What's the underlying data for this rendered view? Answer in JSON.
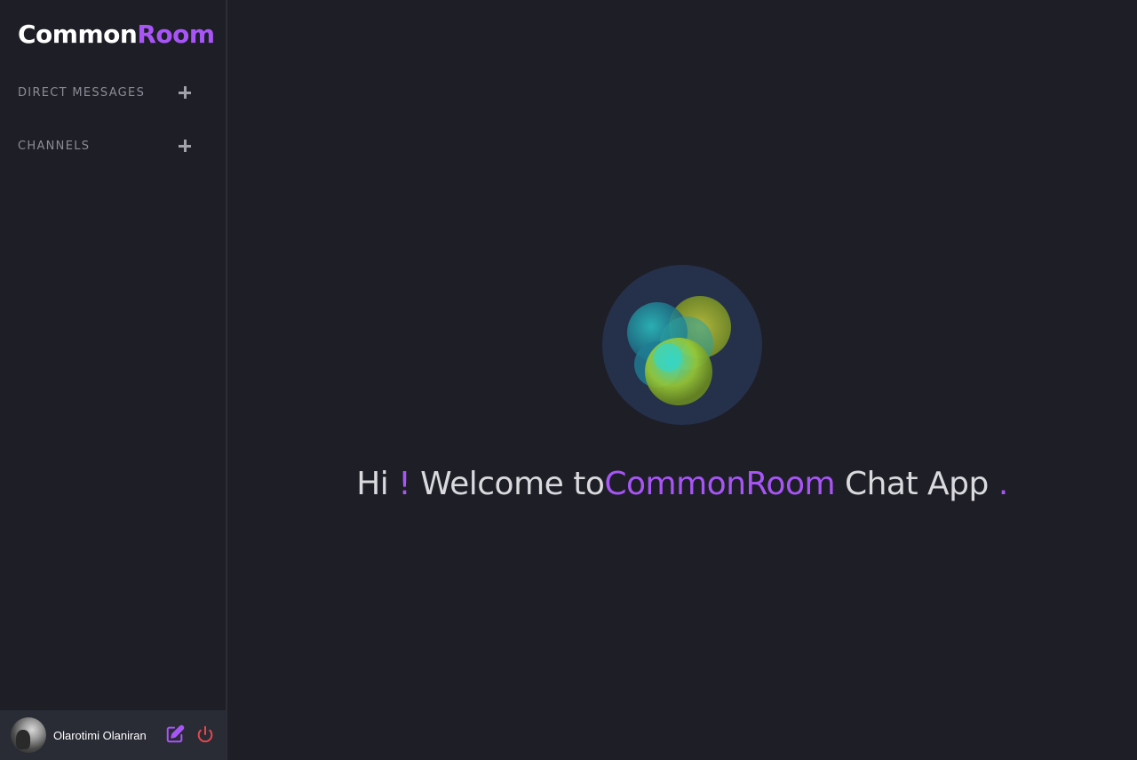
{
  "brand": {
    "part1": "Common",
    "part2": "Room",
    "accent_color": "#a855f7"
  },
  "sidebar": {
    "sections": [
      {
        "label": "DIRECT MESSAGES",
        "action_icon": "plus-icon"
      },
      {
        "label": "CHANNELS",
        "action_icon": "plus-icon"
      }
    ]
  },
  "user": {
    "name": "Olarotimi Olaniran",
    "avatar_icon": "avatar-photo",
    "edit_icon": "edit-icon",
    "logout_icon": "power-icon",
    "edit_color": "#a855f7",
    "logout_color": "#e5484d"
  },
  "welcome": {
    "hi": "Hi ",
    "bang": "!",
    "welcome_to": " Welcome to",
    "brand": "CommonRoom",
    "chat_app": " Chat App ",
    "dot": "."
  },
  "hero": {
    "icon": "commonroom-orb-logo"
  }
}
